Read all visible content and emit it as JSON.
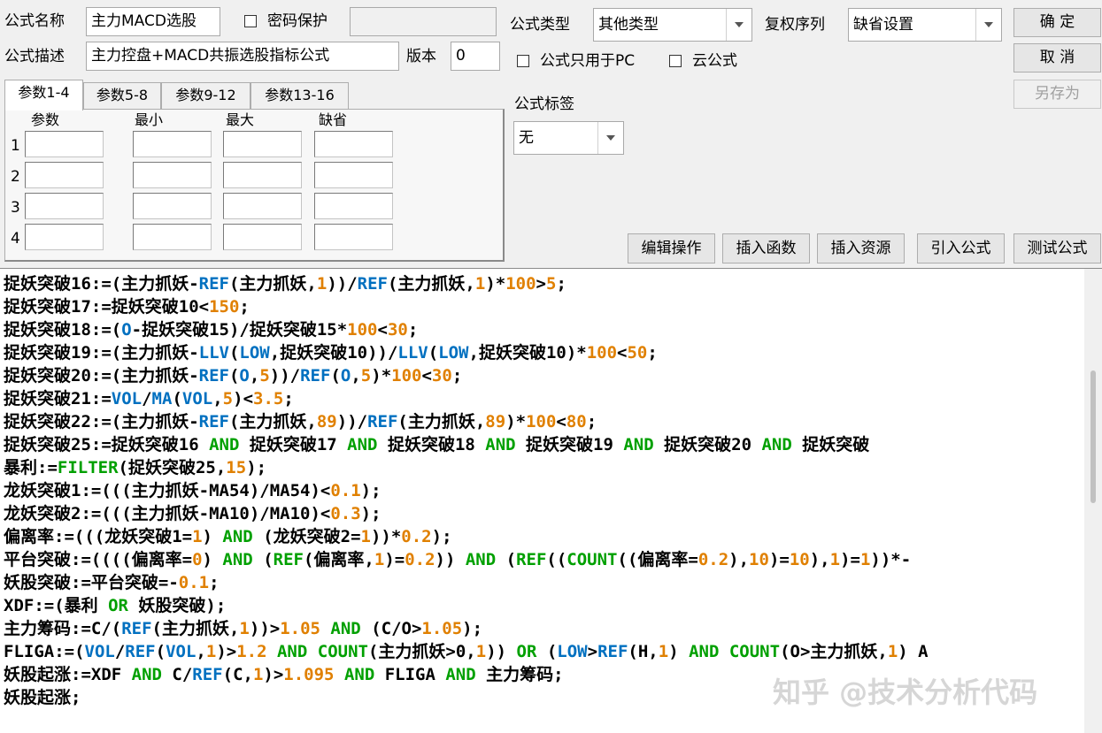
{
  "form": {
    "name_label": "公式名称",
    "name_value": "主力MACD选股",
    "password_label": "密码保护",
    "password_value": "",
    "desc_label": "公式描述",
    "desc_value": "主力控盘+MACD共振选股指标公式",
    "version_label": "版本",
    "version_value": "0",
    "type_label": "公式类型",
    "type_value": "其他类型",
    "adjust_label": "复权序列",
    "adjust_value": "缺省设置",
    "pc_only_label": "公式只用于PC",
    "cloud_label": "云公式",
    "tag_label": "公式标签",
    "tag_value": "无"
  },
  "buttons": {
    "ok": "确 定",
    "cancel": "取 消",
    "save_as": "另存为",
    "edit_ops": "编辑操作",
    "insert_func": "插入函数",
    "insert_res": "插入资源",
    "import_formula": "引入公式",
    "test_formula": "测试公式"
  },
  "params": {
    "tabs": [
      "参数1-4",
      "参数5-8",
      "参数9-12",
      "参数13-16"
    ],
    "headers": [
      "参数",
      "最小",
      "最大",
      "缺省"
    ],
    "rows": [
      "1",
      "2",
      "3",
      "4"
    ]
  },
  "colors": {
    "keyword": "#00a000",
    "function": "#0070c0",
    "number": "#e08000",
    "text": "#000000"
  },
  "code_lines": [
    [
      [
        "t",
        "捉妖突破16:=(主力抓妖-"
      ],
      [
        "f",
        "REF"
      ],
      [
        "t",
        "(主力抓妖,"
      ],
      [
        "n",
        "1"
      ],
      [
        "t",
        "))/"
      ],
      [
        "f",
        "REF"
      ],
      [
        "t",
        "(主力抓妖,"
      ],
      [
        "n",
        "1"
      ],
      [
        "t",
        ")*"
      ],
      [
        "n",
        "100"
      ],
      [
        "t",
        ">"
      ],
      [
        "n",
        "5"
      ],
      [
        "t",
        ";"
      ]
    ],
    [
      [
        "t",
        "捉妖突破17:=捉妖突破10<"
      ],
      [
        "n",
        "150"
      ],
      [
        "t",
        ";"
      ]
    ],
    [
      [
        "t",
        "捉妖突破18:=("
      ],
      [
        "f",
        "O"
      ],
      [
        "t",
        "-捉妖突破15)/捉妖突破15*"
      ],
      [
        "n",
        "100"
      ],
      [
        "t",
        "<"
      ],
      [
        "n",
        "30"
      ],
      [
        "t",
        ";"
      ]
    ],
    [
      [
        "t",
        "捉妖突破19:=(主力抓妖-"
      ],
      [
        "f",
        "LLV"
      ],
      [
        "t",
        "("
      ],
      [
        "f",
        "LOW"
      ],
      [
        "t",
        ",捉妖突破10))/"
      ],
      [
        "f",
        "LLV"
      ],
      [
        "t",
        "("
      ],
      [
        "f",
        "LOW"
      ],
      [
        "t",
        ",捉妖突破10)*"
      ],
      [
        "n",
        "100"
      ],
      [
        "t",
        "<"
      ],
      [
        "n",
        "50"
      ],
      [
        "t",
        ";"
      ]
    ],
    [
      [
        "t",
        "捉妖突破20:=(主力抓妖-"
      ],
      [
        "f",
        "REF"
      ],
      [
        "t",
        "("
      ],
      [
        "f",
        "O"
      ],
      [
        "t",
        ","
      ],
      [
        "n",
        "5"
      ],
      [
        "t",
        "))/"
      ],
      [
        "f",
        "REF"
      ],
      [
        "t",
        "("
      ],
      [
        "f",
        "O"
      ],
      [
        "t",
        ","
      ],
      [
        "n",
        "5"
      ],
      [
        "t",
        ")*"
      ],
      [
        "n",
        "100"
      ],
      [
        "t",
        "<"
      ],
      [
        "n",
        "30"
      ],
      [
        "t",
        ";"
      ]
    ],
    [
      [
        "t",
        "捉妖突破21:="
      ],
      [
        "f",
        "VOL"
      ],
      [
        "t",
        "/"
      ],
      [
        "f",
        "MA"
      ],
      [
        "t",
        "("
      ],
      [
        "f",
        "VOL"
      ],
      [
        "t",
        ","
      ],
      [
        "n",
        "5"
      ],
      [
        "t",
        ")<"
      ],
      [
        "n",
        "3.5"
      ],
      [
        "t",
        ";"
      ]
    ],
    [
      [
        "t",
        "捉妖突破22:=(主力抓妖-"
      ],
      [
        "f",
        "REF"
      ],
      [
        "t",
        "(主力抓妖,"
      ],
      [
        "n",
        "89"
      ],
      [
        "t",
        "))/"
      ],
      [
        "f",
        "REF"
      ],
      [
        "t",
        "(主力抓妖,"
      ],
      [
        "n",
        "89"
      ],
      [
        "t",
        ")*"
      ],
      [
        "n",
        "100"
      ],
      [
        "t",
        "<"
      ],
      [
        "n",
        "80"
      ],
      [
        "t",
        ";"
      ]
    ],
    [
      [
        "t",
        "捉妖突破25:=捉妖突破16 "
      ],
      [
        "k",
        "AND"
      ],
      [
        "t",
        " 捉妖突破17 "
      ],
      [
        "k",
        "AND"
      ],
      [
        "t",
        " 捉妖突破18 "
      ],
      [
        "k",
        "AND"
      ],
      [
        "t",
        " 捉妖突破19 "
      ],
      [
        "k",
        "AND"
      ],
      [
        "t",
        " 捉妖突破20 "
      ],
      [
        "k",
        "AND"
      ],
      [
        "t",
        " 捉妖突破"
      ]
    ],
    [
      [
        "t",
        "暴利:="
      ],
      [
        "k",
        "FILTER"
      ],
      [
        "t",
        "(捉妖突破25,"
      ],
      [
        "n",
        "15"
      ],
      [
        "t",
        ");"
      ]
    ],
    [
      [
        "t",
        "龙妖突破1:=(((主力抓妖-MA54)/MA54)<"
      ],
      [
        "n",
        "0.1"
      ],
      [
        "t",
        ");"
      ]
    ],
    [
      [
        "t",
        "龙妖突破2:=(((主力抓妖-MA10)/MA10)<"
      ],
      [
        "n",
        "0.3"
      ],
      [
        "t",
        ");"
      ]
    ],
    [
      [
        "t",
        "偏离率:=(((龙妖突破1="
      ],
      [
        "n",
        "1"
      ],
      [
        "t",
        ") "
      ],
      [
        "k",
        "AND"
      ],
      [
        "t",
        " (龙妖突破2="
      ],
      [
        "n",
        "1"
      ],
      [
        "t",
        "))*"
      ],
      [
        "n",
        "0.2"
      ],
      [
        "t",
        ");"
      ]
    ],
    [
      [
        "t",
        "平台突破:=((((偏离率="
      ],
      [
        "n",
        "0"
      ],
      [
        "t",
        ") "
      ],
      [
        "k",
        "AND"
      ],
      [
        "t",
        " ("
      ],
      [
        "k",
        "REF"
      ],
      [
        "t",
        "(偏离率,"
      ],
      [
        "n",
        "1"
      ],
      [
        "t",
        ")="
      ],
      [
        "n",
        "0.2"
      ],
      [
        "t",
        ")) "
      ],
      [
        "k",
        "AND"
      ],
      [
        "t",
        " ("
      ],
      [
        "k",
        "REF"
      ],
      [
        "t",
        "(("
      ],
      [
        "k",
        "COUNT"
      ],
      [
        "t",
        "((偏离率="
      ],
      [
        "n",
        "0.2"
      ],
      [
        "t",
        "),"
      ],
      [
        "n",
        "10"
      ],
      [
        "t",
        ")="
      ],
      [
        "n",
        "10"
      ],
      [
        "t",
        "),"
      ],
      [
        "n",
        "1"
      ],
      [
        "t",
        ")="
      ],
      [
        "n",
        "1"
      ],
      [
        "t",
        "))*-"
      ]
    ],
    [
      [
        "t",
        "妖股突破:=平台突破=-"
      ],
      [
        "n",
        "0.1"
      ],
      [
        "t",
        ";"
      ]
    ],
    [
      [
        "t",
        "XDF:=(暴利 "
      ],
      [
        "k",
        "OR"
      ],
      [
        "t",
        " 妖股突破);"
      ]
    ],
    [
      [
        "t",
        "主力筹码:=C/("
      ],
      [
        "f",
        "REF"
      ],
      [
        "t",
        "(主力抓妖,"
      ],
      [
        "n",
        "1"
      ],
      [
        "t",
        "))>"
      ],
      [
        "n",
        "1.05"
      ],
      [
        "t",
        " "
      ],
      [
        "k",
        "AND"
      ],
      [
        "t",
        " (C/O>"
      ],
      [
        "n",
        "1.05"
      ],
      [
        "t",
        ");"
      ]
    ],
    [
      [
        "t",
        "FLIGA:=("
      ],
      [
        "f",
        "VOL"
      ],
      [
        "t",
        "/"
      ],
      [
        "f",
        "REF"
      ],
      [
        "t",
        "("
      ],
      [
        "f",
        "VOL"
      ],
      [
        "t",
        ","
      ],
      [
        "n",
        "1"
      ],
      [
        "t",
        ")>"
      ],
      [
        "n",
        "1.2"
      ],
      [
        "t",
        " "
      ],
      [
        "k",
        "AND"
      ],
      [
        "t",
        " "
      ],
      [
        "k",
        "COUNT"
      ],
      [
        "t",
        "(主力抓妖>0,"
      ],
      [
        "n",
        "1"
      ],
      [
        "t",
        ")) "
      ],
      [
        "k",
        "OR"
      ],
      [
        "t",
        " ("
      ],
      [
        "f",
        "LOW"
      ],
      [
        "t",
        ">"
      ],
      [
        "f",
        "REF"
      ],
      [
        "t",
        "(H,"
      ],
      [
        "n",
        "1"
      ],
      [
        "t",
        ") "
      ],
      [
        "k",
        "AND"
      ],
      [
        "t",
        " "
      ],
      [
        "k",
        "COUNT"
      ],
      [
        "t",
        "(O>主力抓妖,"
      ],
      [
        "n",
        "1"
      ],
      [
        "t",
        ") A"
      ]
    ],
    [
      [
        "t",
        "妖股起涨:=XDF "
      ],
      [
        "k",
        "AND"
      ],
      [
        "t",
        " C/"
      ],
      [
        "f",
        "REF"
      ],
      [
        "t",
        "(C,"
      ],
      [
        "n",
        "1"
      ],
      [
        "t",
        ")>"
      ],
      [
        "n",
        "1.095"
      ],
      [
        "t",
        " "
      ],
      [
        "k",
        "AND"
      ],
      [
        "t",
        " FLIGA "
      ],
      [
        "k",
        "AND"
      ],
      [
        "t",
        " 主力筹码;"
      ]
    ],
    [
      [
        "t",
        "妖股起涨;"
      ]
    ]
  ],
  "watermark": "知乎 @技术分析代码"
}
